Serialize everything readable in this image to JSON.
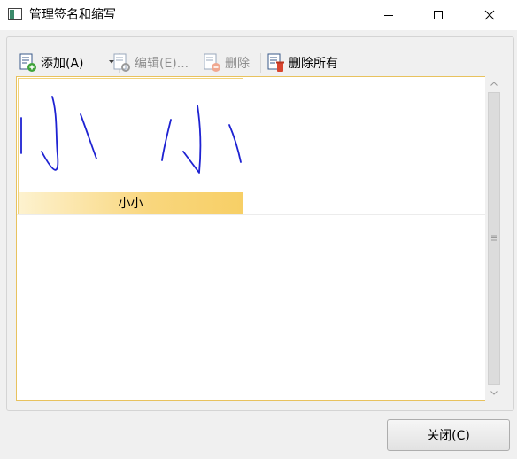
{
  "window": {
    "title": "管理签名和缩写"
  },
  "toolbar": {
    "add_label": "添加(A)",
    "edit_label": "编辑(E)...",
    "delete_label": "删除",
    "delete_all_label": "删除所有"
  },
  "signatures": [
    {
      "caption": "小小"
    }
  ],
  "footer": {
    "close_label": "关闭(C)"
  },
  "colors": {
    "accent": "#f9d67c",
    "ink": "#1e22d2",
    "list_border": "#e8c25e"
  }
}
